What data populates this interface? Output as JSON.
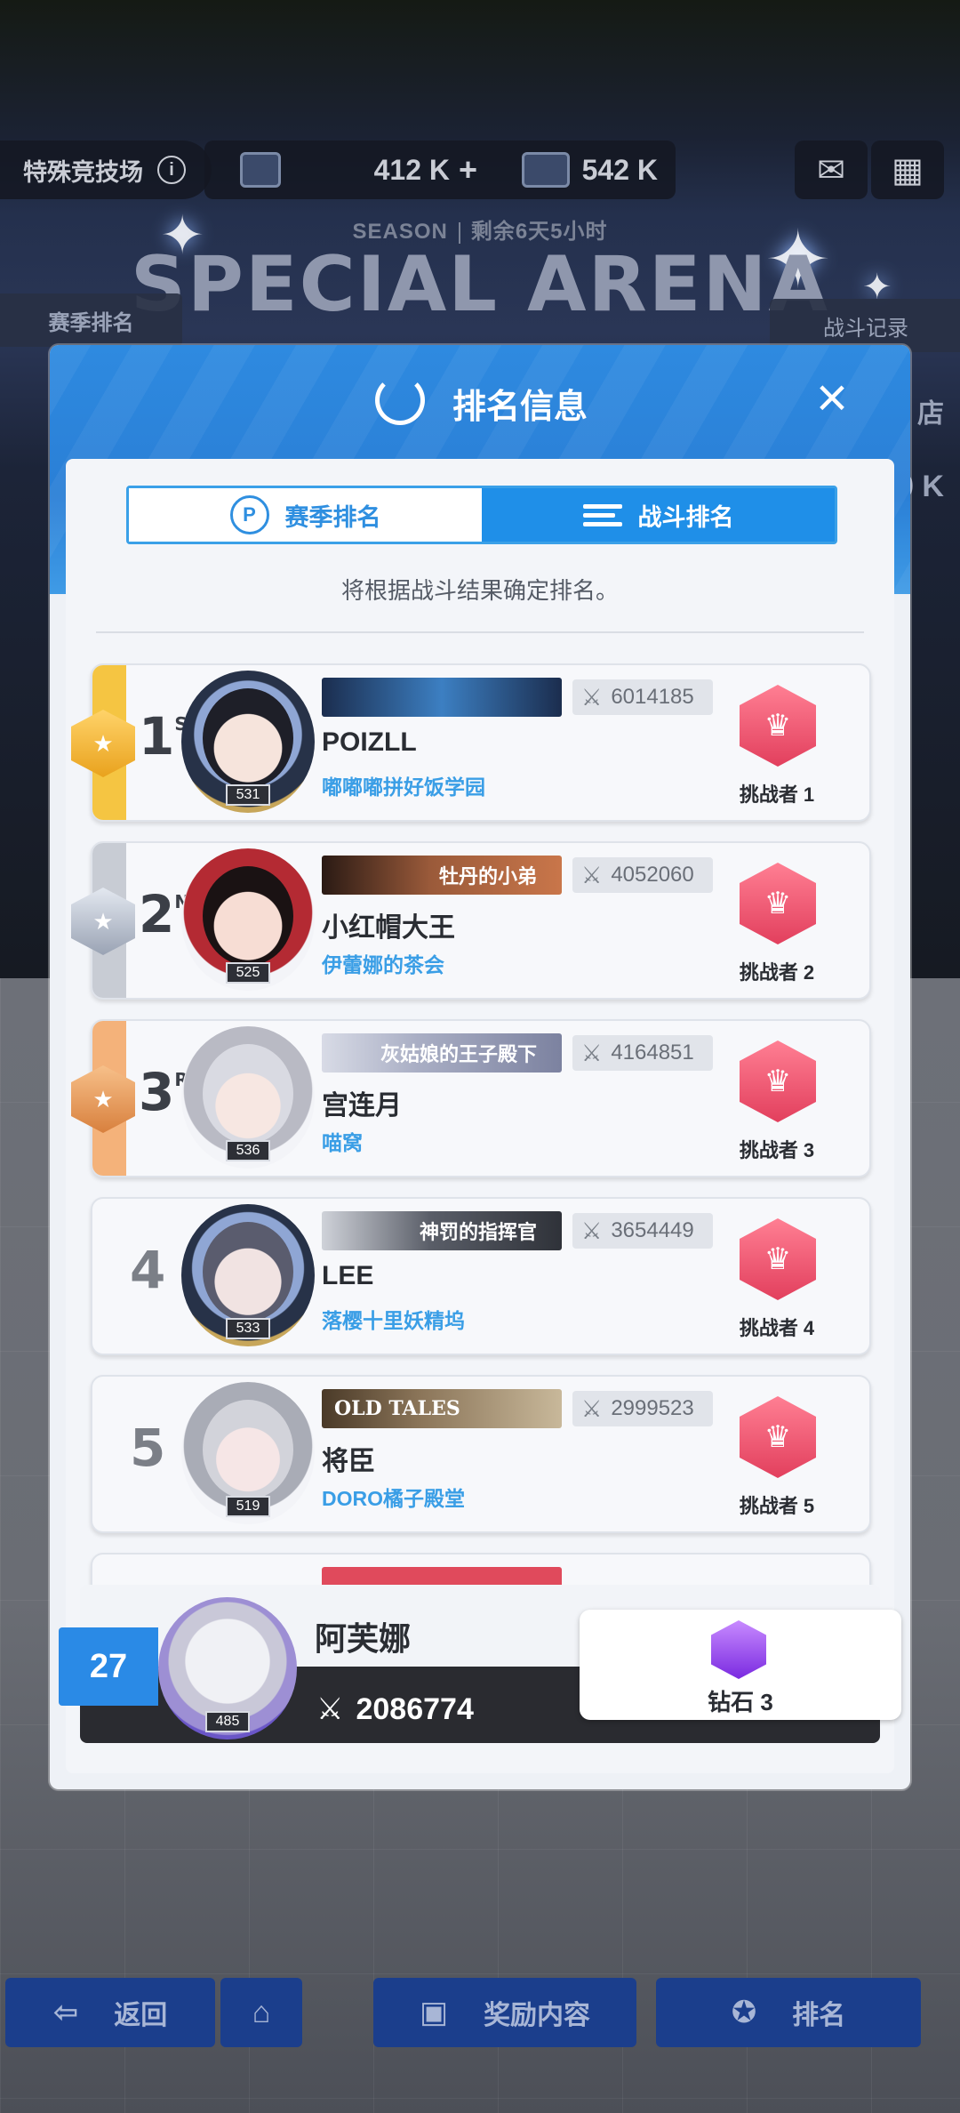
{
  "topbar": {
    "mode_label": "特殊竞技场",
    "currency1": "412 K",
    "currency2": "542 K"
  },
  "season": {
    "label": "SEASON",
    "remaining": "剩余6天5小时",
    "title": "SPECIAL ARENA"
  },
  "side": {
    "left_tab": "赛季排名",
    "right_tab": "战斗记录",
    "right_partial_1": "店",
    "right_partial_2": "0 K"
  },
  "modal": {
    "title": "排名信息",
    "tabs": [
      {
        "label": "赛季排名",
        "active": false
      },
      {
        "label": "战斗排名",
        "active": true
      }
    ],
    "hint": "将根据战斗结果确定排名。"
  },
  "rankings": [
    {
      "rank": "1",
      "suffix": "ST",
      "level": "531",
      "banner": "",
      "power": "6014185",
      "name": "POIZLL",
      "guild": "嘟嘟嘟拼好饭学园",
      "challenger": "挑战者 1",
      "stripe": "#f5c542"
    },
    {
      "rank": "2",
      "suffix": "ND",
      "level": "525",
      "banner": "牡丹的小弟",
      "power": "4052060",
      "name": "小红帽大王",
      "guild": "伊蕾娜的茶会",
      "challenger": "挑战者 2",
      "stripe": "#c8ccd4"
    },
    {
      "rank": "3",
      "suffix": "RD",
      "level": "536",
      "banner": "灰姑娘的王子殿下",
      "power": "4164851",
      "name": "宫连月",
      "guild": "喵窝",
      "challenger": "挑战者 3",
      "stripe": "#f4b27a"
    },
    {
      "rank": "4",
      "suffix": "",
      "level": "533",
      "banner": "神罚的指挥官",
      "power": "3654449",
      "name": "LEE",
      "guild": "落樱十里妖精坞",
      "challenger": "挑战者 4",
      "stripe": ""
    },
    {
      "rank": "5",
      "suffix": "",
      "level": "519",
      "banner": "OLD TALES",
      "power": "2999523",
      "name": "将臣",
      "guild": "DORO橘子殿堂",
      "challenger": "挑战者 5",
      "stripe": ""
    }
  ],
  "me": {
    "rank": "27",
    "level": "485",
    "name": "阿芙娜",
    "power": "2086774",
    "tier": "钻石 3"
  },
  "bottom_nav": {
    "back": "返回",
    "rewards": "奖励内容",
    "ranking": "排名"
  }
}
